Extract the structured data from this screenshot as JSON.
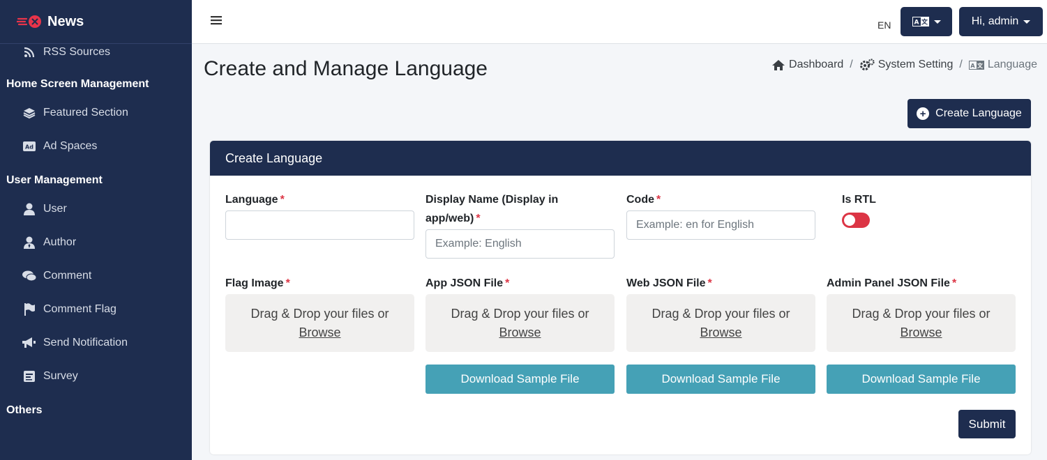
{
  "sidebar": {
    "brand": "News",
    "items": [
      {
        "label": "RSS Sources",
        "icon": "rss-icon"
      },
      {
        "header": "Home Screen Management"
      },
      {
        "label": "Featured Section",
        "icon": "layers-icon"
      },
      {
        "label": "Ad Spaces",
        "icon": "ad-icon"
      },
      {
        "header": "User Management"
      },
      {
        "label": "User",
        "icon": "user-icon"
      },
      {
        "label": "Author",
        "icon": "author-icon"
      },
      {
        "label": "Comment",
        "icon": "comments-icon"
      },
      {
        "label": "Comment Flag",
        "icon": "flag-icon"
      },
      {
        "label": "Send Notification",
        "icon": "megaphone-icon"
      },
      {
        "label": "Survey",
        "icon": "poll-icon"
      },
      {
        "header": "Others"
      }
    ]
  },
  "topbar": {
    "lang_code": "EN",
    "user_greeting": "Hi, admin"
  },
  "page": {
    "title": "Create and Manage Language",
    "breadcrumb": [
      "Dashboard",
      "System Setting",
      "Language"
    ],
    "create_button": "Create Language"
  },
  "form": {
    "card_title": "Create Language",
    "language_label": "Language",
    "language_value": "",
    "display_name_label_line1": "Display Name (Display in",
    "display_name_label_line2": "app/web)",
    "display_name_placeholder": "Example: English",
    "code_label": "Code",
    "code_placeholder": "Example: en for English",
    "rtl_label": "Is RTL",
    "rtl_enabled": false,
    "flag_label": "Flag Image",
    "app_json_label": "App JSON File",
    "web_json_label": "Web JSON File",
    "admin_json_label": "Admin Panel JSON File",
    "dropzone_text": "Drag & Drop your files or",
    "dropzone_browse": "Browse",
    "download_label": "Download Sample File",
    "required_mark": "*",
    "submit_label": "Submit"
  },
  "colors": {
    "primary": "#1e2d4f",
    "info": "#45a1b6",
    "danger": "#dc3545",
    "background": "#f4f6f9"
  }
}
